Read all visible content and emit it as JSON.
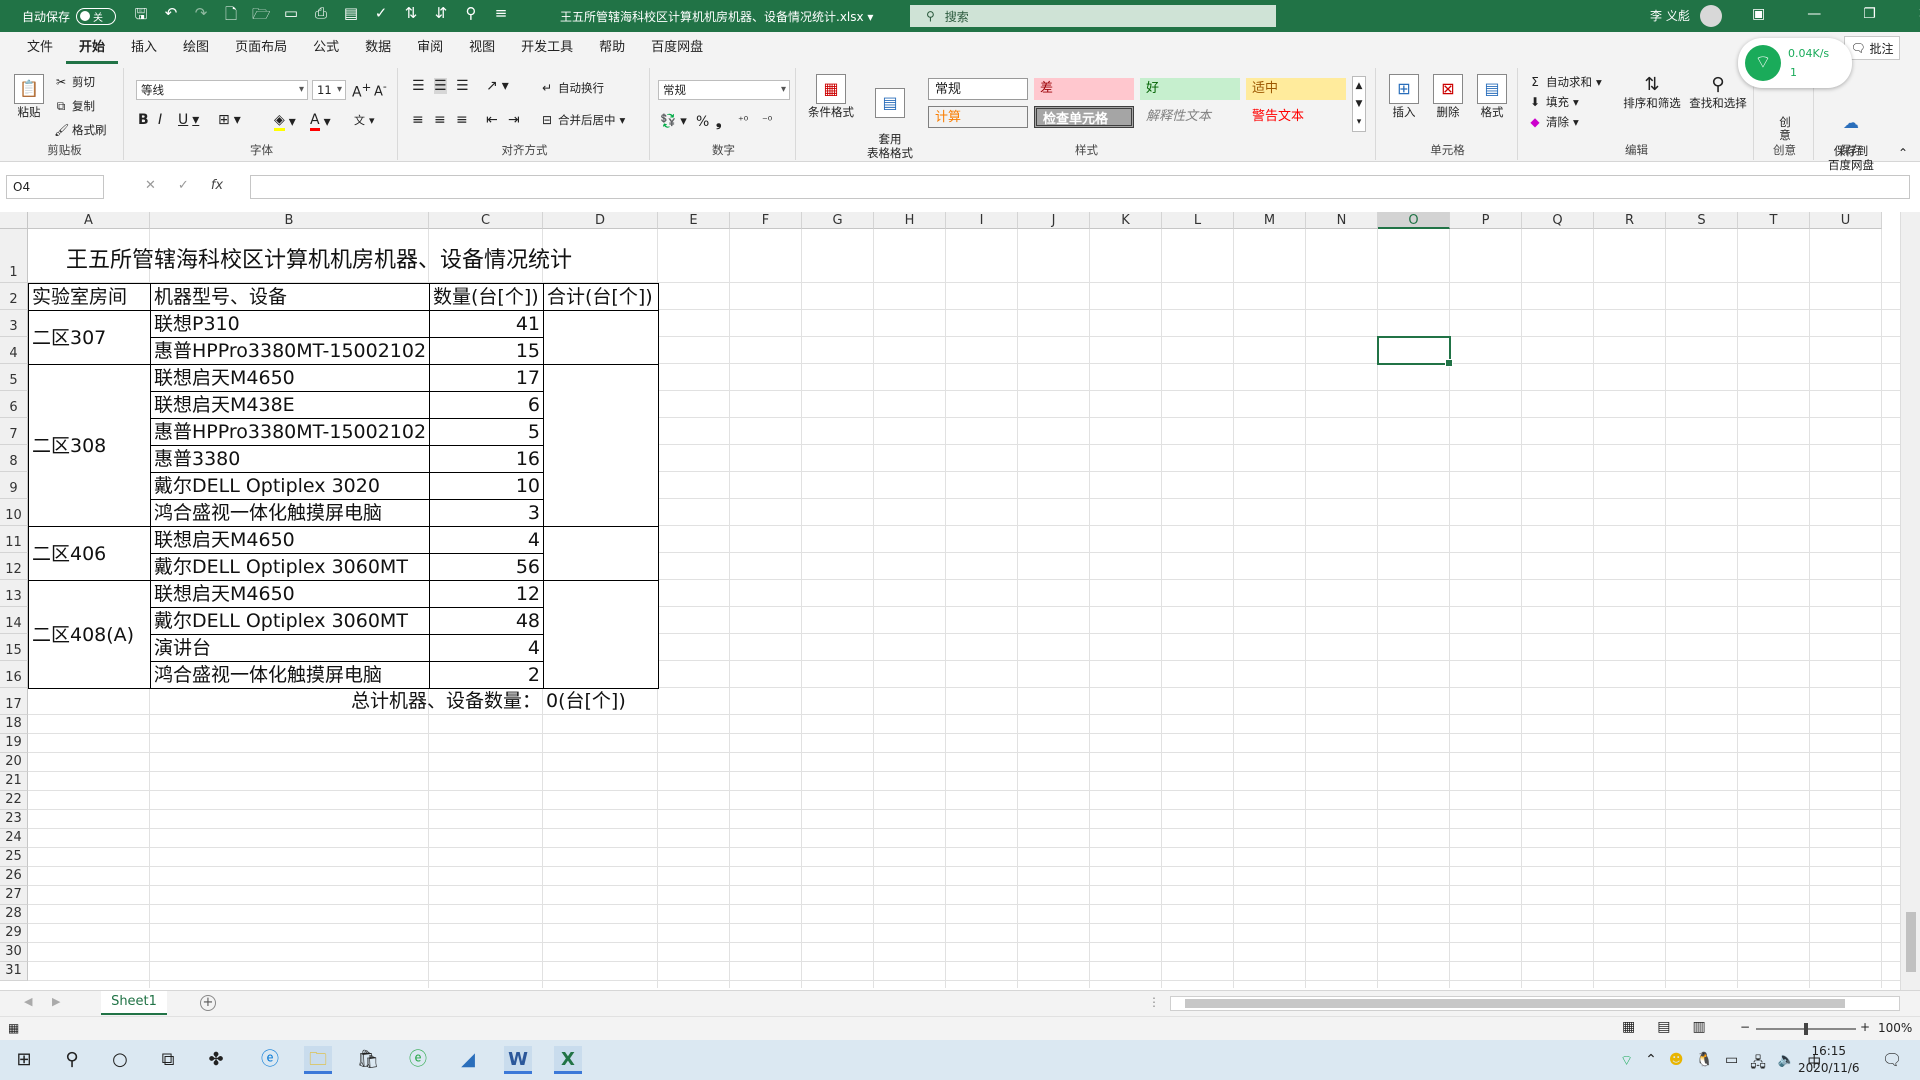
{
  "titlebar": {
    "autosave_label": "自动保存",
    "autosave_state": "关",
    "doc_title": "王五所管辖海科校区计算机机房机器、设备情况统计.xlsx",
    "search_placeholder": "搜索",
    "user_name": "李 义彪"
  },
  "tabs": [
    "文件",
    "开始",
    "插入",
    "绘图",
    "页面布局",
    "公式",
    "数据",
    "审阅",
    "视图",
    "开发工具",
    "帮助",
    "百度网盘"
  ],
  "comment_label": "批注",
  "network": {
    "rate": "0.04K/s",
    "count": "1"
  },
  "ribbon": {
    "clipboard": {
      "paste": "粘贴",
      "cut": "剪切",
      "copy": "复制",
      "format_painter": "格式刷",
      "label": "剪贴板"
    },
    "font": {
      "name": "等线",
      "size": "11",
      "label": "字体"
    },
    "alignment": {
      "wrap": "自动换行",
      "merge": "合并后居中",
      "label": "对齐方式"
    },
    "number": {
      "format": "常规",
      "label": "数字"
    },
    "styles": {
      "conditional": "条件格式",
      "table": "套用\n表格格式",
      "normal": "常规",
      "bad": "差",
      "good": "好",
      "neutral": "适中",
      "calc": "计算",
      "check": "检查单元格",
      "explain": "解释性文本",
      "warn": "警告文本",
      "label": "样式"
    },
    "cells": {
      "insert": "插入",
      "delete": "删除",
      "format": "格式",
      "label": "单元格"
    },
    "editing": {
      "autosum": "自动求和",
      "fill": "填充",
      "clear": "清除",
      "sort": "排序和筛选",
      "find": "查找和选择",
      "label": "编辑"
    },
    "create": {
      "label": "创意",
      "btn": "创\n意"
    },
    "save": {
      "btn": "保存到\n百度网盘",
      "label": "保存"
    }
  },
  "formulabar": {
    "namebox": "O4",
    "fx": "fx",
    "content": ""
  },
  "columns": [
    "A",
    "B",
    "C",
    "D",
    "E",
    "F",
    "G",
    "H",
    "I",
    "J",
    "K",
    "L",
    "M",
    "N",
    "O",
    "P",
    "Q",
    "R",
    "S",
    "T",
    "U"
  ],
  "selected_column": "O",
  "rows": [
    "1",
    "2",
    "3",
    "4",
    "5",
    "6",
    "7",
    "8",
    "9",
    "10",
    "11",
    "12",
    "13",
    "14",
    "15",
    "16",
    "17",
    "18",
    "19",
    "20",
    "21",
    "22",
    "23",
    "24",
    "25",
    "26",
    "27",
    "28",
    "29",
    "30",
    "31"
  ],
  "sheet": {
    "title": "王五所管辖海科校区计算机机房机器、设备情况统计",
    "headers": [
      "实验室房间",
      "机器型号、设备",
      "数量(台[个])",
      "合计(台[个])"
    ],
    "groups": [
      {
        "room": "二区307",
        "items": [
          {
            "model": "联想P310",
            "qty": "41"
          },
          {
            "model": "惠普HPPro3380MT-15002102",
            "qty": "15"
          }
        ]
      },
      {
        "room": "二区308",
        "items": [
          {
            "model": "联想启天M4650",
            "qty": "17"
          },
          {
            "model": "联想启天M438E",
            "qty": "6"
          },
          {
            "model": "惠普HPPro3380MT-15002102",
            "qty": "5"
          },
          {
            "model": "惠普3380",
            "qty": "16"
          },
          {
            "model": "戴尔DELL Optiplex 3020",
            "qty": "10"
          },
          {
            "model": "鸿合盛视一体化触摸屏电脑",
            "qty": "3"
          }
        ]
      },
      {
        "room": "二区406",
        "items": [
          {
            "model": "联想启天M4650",
            "qty": "4"
          },
          {
            "model": "戴尔DELL Optiplex 3060MT",
            "qty": "56"
          }
        ]
      },
      {
        "room": "二区408(A)",
        "items": [
          {
            "model": "联想启天M4650",
            "qty": "12"
          },
          {
            "model": "戴尔DELL Optiplex 3060MT",
            "qty": "48"
          },
          {
            "model": "演讲台",
            "qty": "4"
          },
          {
            "model": "鸿合盛视一体化触摸屏电脑",
            "qty": "2"
          }
        ]
      }
    ],
    "total_label": "总计机器、设备数量：",
    "total_value": "0(台[个])"
  },
  "sheet_tab": "Sheet1",
  "status": {
    "zoom": "100%"
  },
  "clock": {
    "time": "16:15",
    "date": "2020/11/6"
  },
  "tray_ime": "中",
  "colors": {
    "accent": "#217346",
    "selection": "#217346"
  }
}
